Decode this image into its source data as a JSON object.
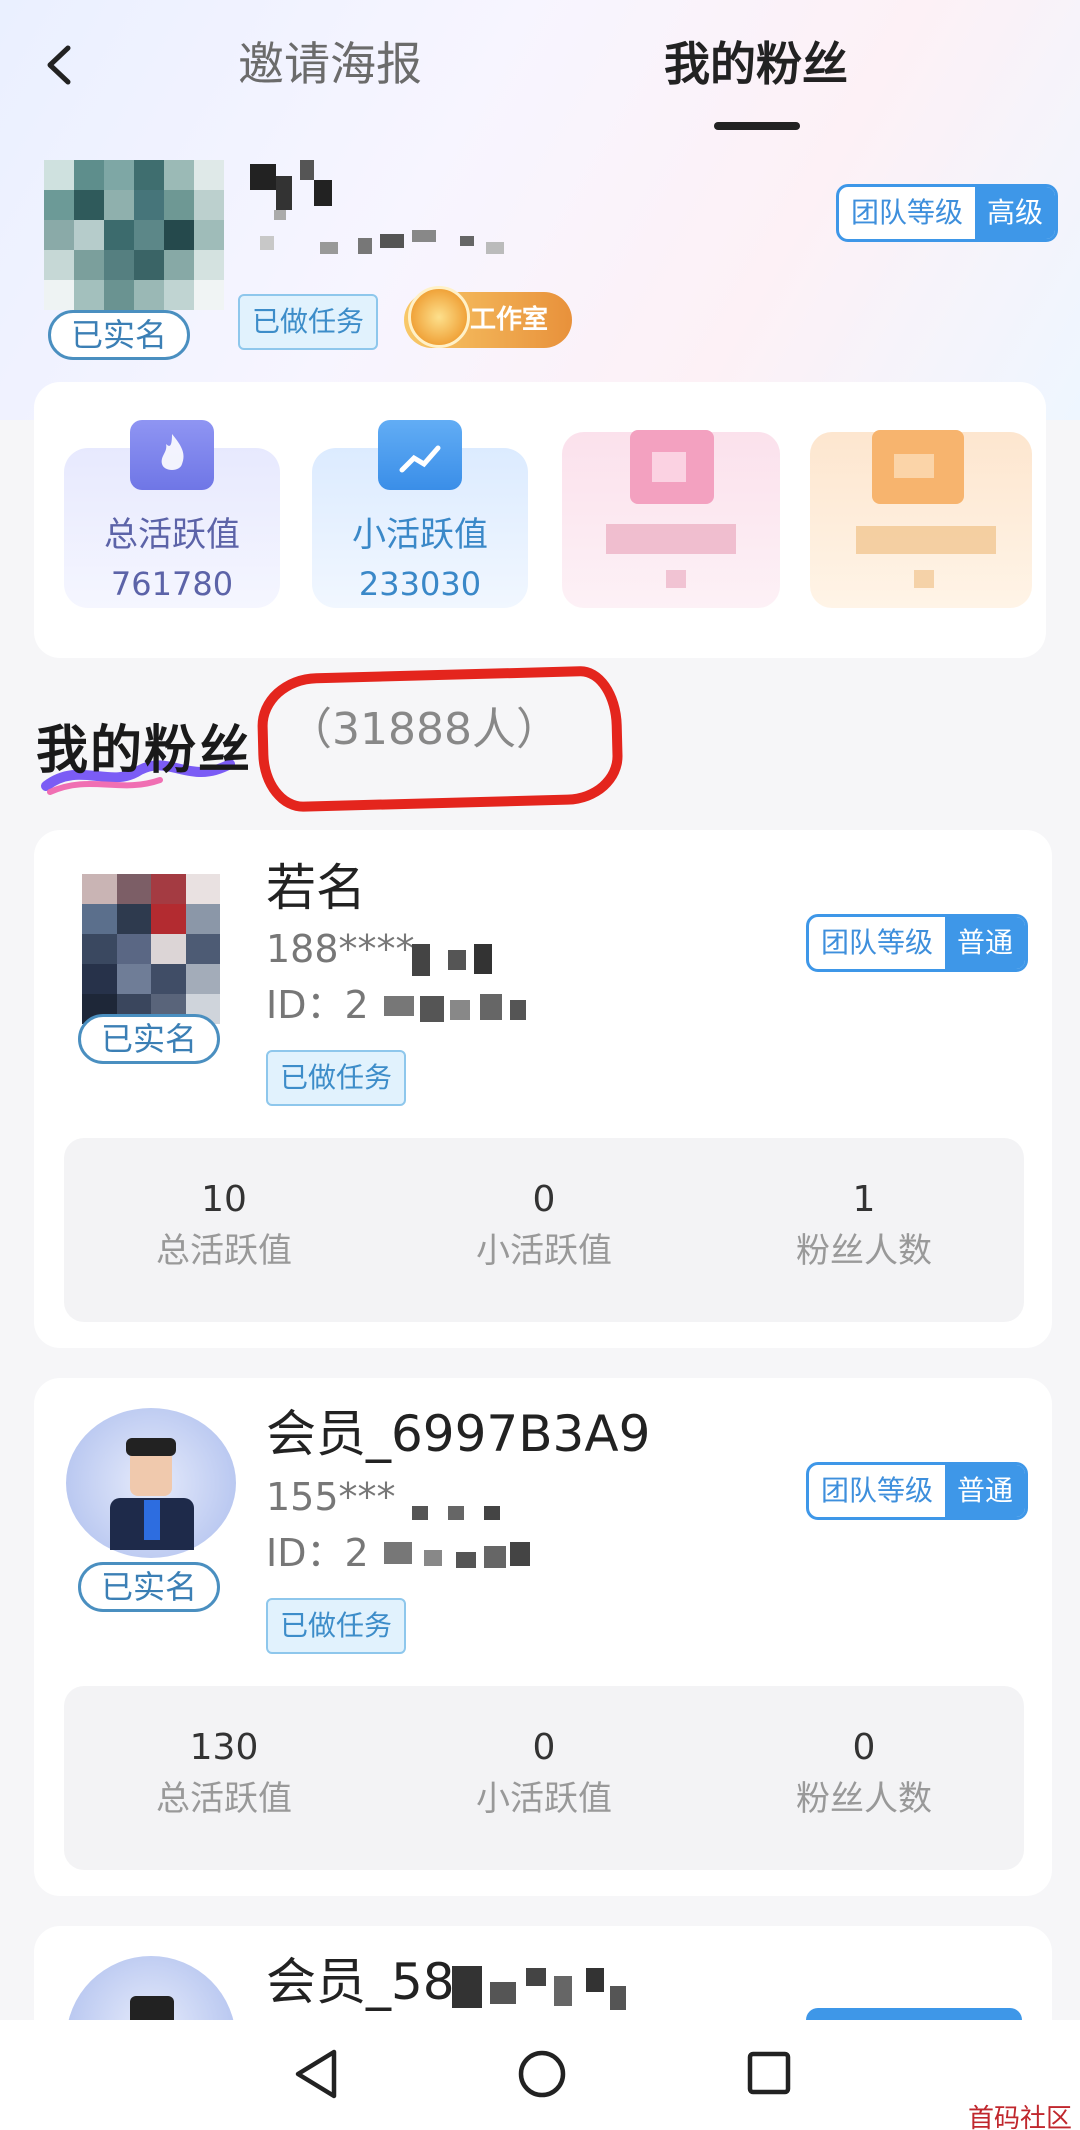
{
  "header": {
    "tab_poster": "邀请海报",
    "tab_fans": "我的粉丝"
  },
  "profile": {
    "verified": "已实名",
    "task_done": "已做任务",
    "studio_badge": "工作室",
    "team_level_label": "团队等级",
    "team_level_value": "高级"
  },
  "stats": [
    {
      "label": "总活跃值",
      "value": "761780"
    },
    {
      "label": "小活跃值",
      "value": "233030"
    }
  ],
  "fans_section": {
    "title": "我的粉丝",
    "count": "（31888人）"
  },
  "fans": [
    {
      "name": "若名",
      "phone": "188****",
      "id": "ID：2",
      "verified": "已实名",
      "task_done": "已做任务",
      "team_level_label": "团队等级",
      "team_level_value": "普通",
      "total_active": "10",
      "total_active_label": "总活跃值",
      "small_active": "0",
      "small_active_label": "小活跃值",
      "fans_count": "1",
      "fans_count_label": "粉丝人数"
    },
    {
      "name": "会员_6997B3A9",
      "phone": "155***",
      "id": "ID：2",
      "verified": "已实名",
      "task_done": "已做任务",
      "team_level_label": "团队等级",
      "team_level_value": "普通",
      "total_active": "130",
      "total_active_label": "总活跃值",
      "small_active": "0",
      "small_active_label": "小活跃值",
      "fans_count": "0",
      "fans_count_label": "粉丝人数"
    },
    {
      "name": "会员_58"
    }
  ],
  "watermark": "首码社区"
}
